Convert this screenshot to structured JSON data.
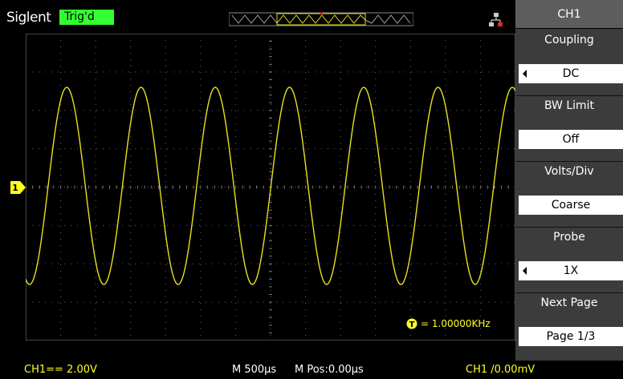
{
  "brand": "Siglent",
  "trig_status": "Trig'd",
  "menu": {
    "title": "CH1",
    "items": [
      {
        "label": "Coupling",
        "value": "DC",
        "has_arrow": true
      },
      {
        "label": "BW Limit",
        "value": "Off",
        "has_arrow": false
      },
      {
        "label": "Volts/Div",
        "value": "Coarse",
        "has_arrow": false
      },
      {
        "label": "Probe",
        "value": "1X",
        "has_arrow": true
      },
      {
        "label": "Next Page",
        "value": "Page 1/3",
        "has_arrow": false
      }
    ]
  },
  "trigger_marker": "T",
  "ch1_marker": "1",
  "frequency": {
    "icon": "T",
    "text": "= 1.00000KHz"
  },
  "status": {
    "ch1_scale": "CH1== 2.00V",
    "timebase": "M 500µs",
    "mpos": "M Pos:0.00µs",
    "trigger": "CH1 /0.00mV"
  },
  "colors": {
    "trace": "#e8e020",
    "accent_green": "#33ff33",
    "status_text": "#ffff20"
  }
}
